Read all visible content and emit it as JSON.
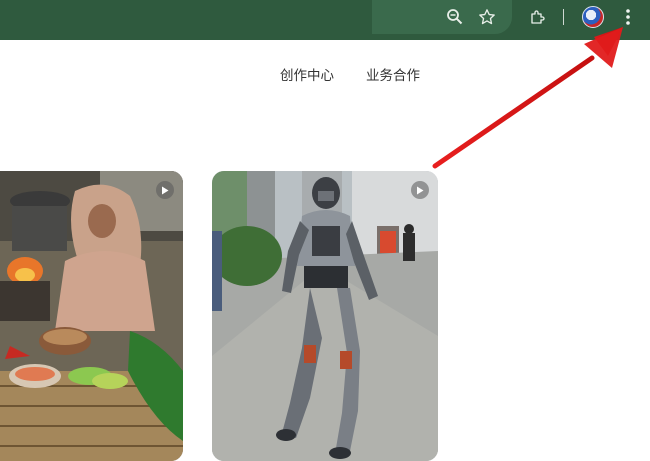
{
  "nav": {
    "items": [
      "创作中心",
      "业务合作"
    ]
  },
  "icons": {
    "zoom": "zoom-icon",
    "bookmark": "star-icon",
    "extensions": "puzzle-icon",
    "menu": "vertical-dots-icon",
    "play": "play-icon"
  },
  "colors": {
    "toolbar": "#2f5a3e",
    "annotation_arrow": "#e01b1b"
  },
  "videos": [
    {
      "kind": "cooking-woman"
    },
    {
      "kind": "walking-robot"
    }
  ]
}
